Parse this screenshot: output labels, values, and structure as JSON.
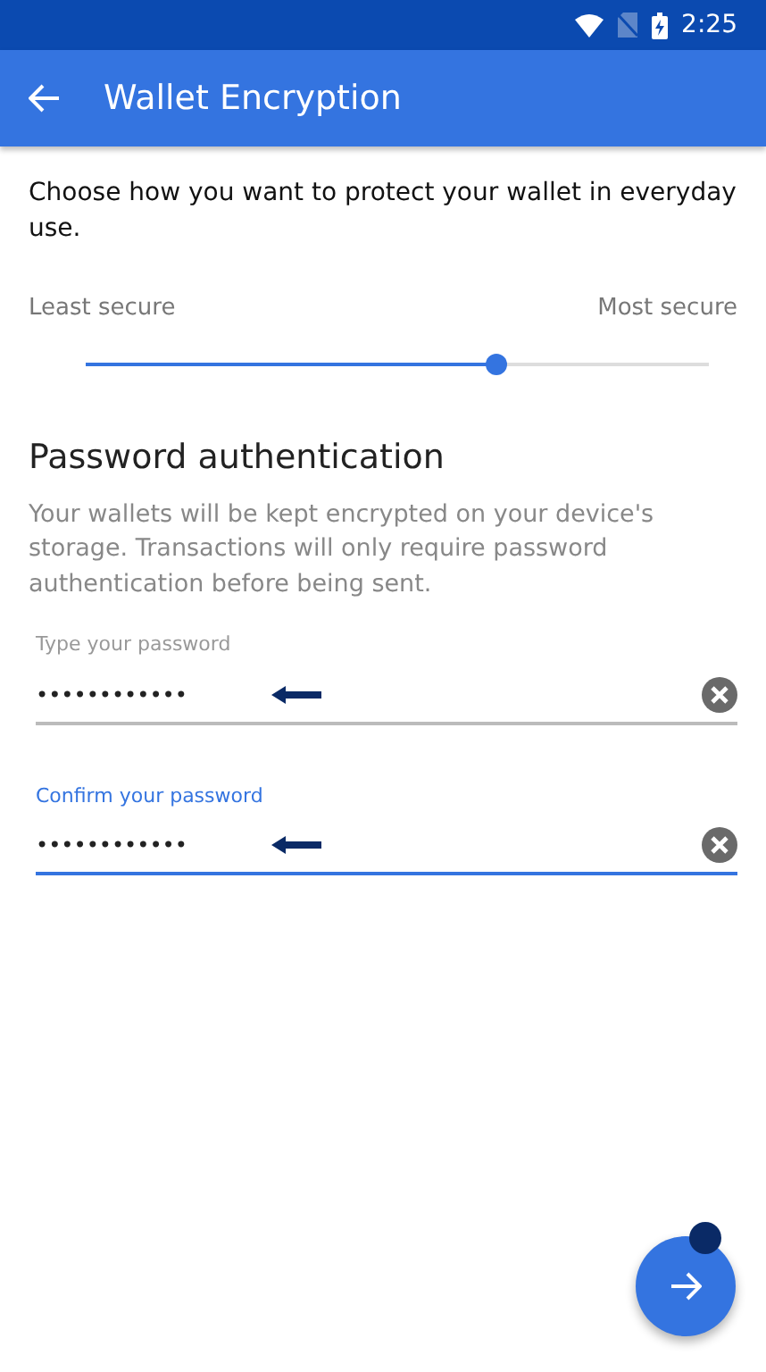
{
  "status_bar": {
    "time": "2:25"
  },
  "app_bar": {
    "title": "Wallet Encryption"
  },
  "intro": "Choose how you want to protect your wallet in everyday use.",
  "security_slider": {
    "min_label": "Least secure",
    "max_label": "Most secure",
    "level": 0.66
  },
  "section": {
    "title": "Password authentication",
    "description": "Your wallets will be kept encrypted on your device's storage. Transactions will only require password authentication before being sent."
  },
  "fields": [
    {
      "label": "Type your password",
      "value": "••••••••••••",
      "focused": false
    },
    {
      "label": "Confirm your password",
      "value": "••••••••••••",
      "focused": true
    }
  ]
}
